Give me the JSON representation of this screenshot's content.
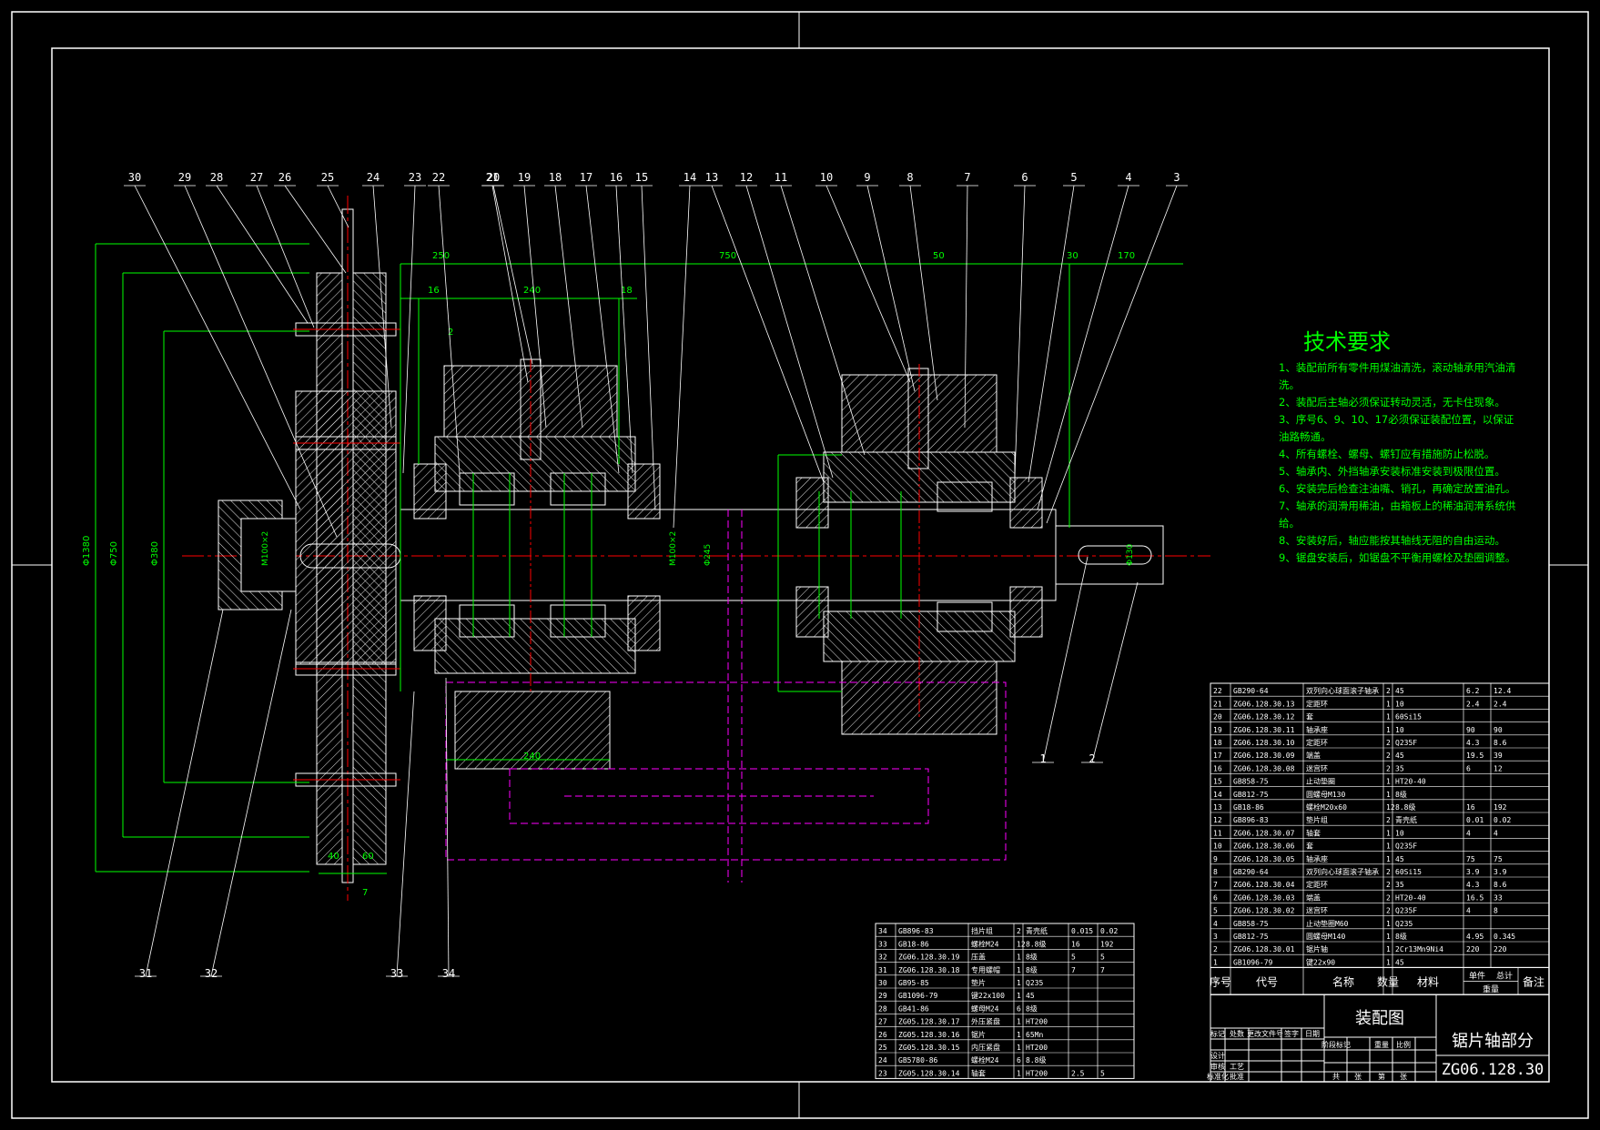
{
  "tech": {
    "title": "技术要求",
    "items": [
      "1、装配前所有零件用煤油清洗，滚动轴承用汽油清",
      "洗。",
      "2、装配后主轴必须保证转动灵活，无卡住现象。",
      "3、序号6、9、10、17必须保证装配位置，以保证",
      "油路畅通。",
      "4、所有螺栓、螺母、螺钉应有措施防止松脱。",
      "5、轴承内、外挡轴承安装标准安装到极限位置。",
      "6、安装完后检查注油嘴、销孔，再确定放置油孔。",
      "7、轴承的润滑用稀油，由箱板上的稀油润滑系统供",
      "给。",
      "8、安装好后，轴应能按其轴线无阻的自由运动。",
      "9、锯盘安装后，如锯盘不平衡用螺栓及垫圈调整。"
    ]
  },
  "balloons_top": [
    "30",
    "29",
    "28",
    "27",
    "26",
    "25",
    "24",
    "23",
    "22",
    "21",
    "20",
    "19",
    "18",
    "17",
    "16",
    "15",
    "14",
    "13",
    "12",
    "11",
    "10",
    "9",
    "8",
    "7",
    "6",
    "5",
    "4",
    "3"
  ],
  "balloons_bottom_left": [
    "31",
    "32",
    "33",
    "34"
  ],
  "balloons_bottom_right": [
    "1",
    "2"
  ],
  "dims": {
    "top_left": "250",
    "top_mid": "750",
    "top_50": "50",
    "top_30": "30",
    "top_170": "170",
    "d16": "16",
    "d240": "240",
    "d18": "18",
    "d2": "2",
    "bottom_40": "40",
    "bottom_60": "60",
    "bottom_7": "7",
    "bottom_240": "240",
    "phi1": "Φ1380",
    "phi2": "Φ750",
    "phi3": "Φ380",
    "m1": "M100×2",
    "m2": "M100×2",
    "s1": "Φ245",
    "s2": "Φ130"
  },
  "bom_left": {
    "rows": [
      [
        "34",
        "GB896-83",
        "挡片组",
        "2",
        "青壳纸",
        "0.015",
        "0.02"
      ],
      [
        "33",
        "GB18-86",
        "螺栓M24",
        "12",
        "8.8级",
        "16",
        "192"
      ],
      [
        "32",
        "ZG06.128.30.19",
        "压盖",
        "1",
        "8级",
        "5",
        "5"
      ],
      [
        "31",
        "ZG06.128.30.18",
        "专用螺帽",
        "1",
        "8级",
        "7",
        "7"
      ],
      [
        "30",
        "GB95-85",
        "垫片",
        "1",
        "Q235",
        "",
        ""
      ],
      [
        "29",
        "GB1096-79",
        "键22x100",
        "1",
        "45",
        "",
        ""
      ],
      [
        "28",
        "GB41-86",
        "螺母M24",
        "6",
        "8级",
        "",
        ""
      ],
      [
        "27",
        "ZG05.128.30.17",
        "外压紧盘",
        "1",
        "HT200",
        "",
        ""
      ],
      [
        "26",
        "ZG05.128.30.16",
        "锯片",
        "1",
        "65Mn",
        "",
        ""
      ],
      [
        "25",
        "ZG05.128.30.15",
        "内压紧盘",
        "1",
        "HT200",
        "",
        ""
      ],
      [
        "24",
        "GB5780-86",
        "螺栓M24",
        "6",
        "8.8级",
        "",
        ""
      ],
      [
        "23",
        "ZG05.128.30.14",
        "轴套",
        "1",
        "HT200",
        "2.5",
        "5"
      ]
    ]
  },
  "bom_right": {
    "rows": [
      [
        "22",
        "GB290-64",
        "双列向心球面滚子轴承",
        "2",
        "45",
        "6.2",
        "12.4"
      ],
      [
        "21",
        "ZG06.128.30.13",
        "定距环",
        "1",
        "10",
        "2.4",
        "2.4"
      ],
      [
        "20",
        "ZG06.128.30.12",
        "套",
        "1",
        "60Si15",
        "",
        ""
      ],
      [
        "19",
        "ZG06.128.30.11",
        "轴承座",
        "1",
        "10",
        "90",
        "90"
      ],
      [
        "18",
        "ZG06.128.30.10",
        "定距环",
        "2",
        "Q235F",
        "4.3",
        "8.6"
      ],
      [
        "17",
        "ZG06.128.30.09",
        "端盖",
        "2",
        "45",
        "19.5",
        "39"
      ],
      [
        "16",
        "ZG06.128.30.08",
        "迷宫环",
        "2",
        "35",
        "6",
        "12"
      ],
      [
        "15",
        "GB858-75",
        "止动垫圈",
        "1",
        "HT20-40",
        "",
        ""
      ],
      [
        "14",
        "GB812-75",
        "圆螺母M130",
        "1",
        "8级",
        "",
        ""
      ],
      [
        "13",
        "GB18-86",
        "螺栓M20x60",
        "12",
        "8.8级",
        "16",
        "192"
      ],
      [
        "12",
        "GB896-83",
        "垫片组",
        "2",
        "青壳纸",
        "0.01",
        "0.02"
      ],
      [
        "11",
        "ZG06.128.30.07",
        "轴套",
        "1",
        "10",
        "4",
        "4"
      ],
      [
        "10",
        "ZG06.128.30.06",
        "套",
        "1",
        "Q235F",
        "",
        ""
      ],
      [
        "9",
        "ZG06.128.30.05",
        "轴承座",
        "1",
        "45",
        "75",
        "75"
      ],
      [
        "8",
        "GB290-64",
        "双列向心球面滚子轴承",
        "2",
        "60Si15",
        "3.9",
        "3.9"
      ],
      [
        "7",
        "ZG06.128.30.04",
        "定距环",
        "2",
        "35",
        "4.3",
        "8.6"
      ],
      [
        "6",
        "ZG06.128.30.03",
        "端盖",
        "2",
        "HT20-40",
        "16.5",
        "33"
      ],
      [
        "5",
        "ZG06.128.30.02",
        "迷宫环",
        "2",
        "Q235F",
        "4",
        "8"
      ],
      [
        "4",
        "GB858-75",
        "止动垫圈M60",
        "1",
        "Q235",
        "",
        ""
      ],
      [
        "3",
        "GB812-75",
        "圆螺母M140",
        "1",
        "8级",
        "4.95",
        "0.345"
      ],
      [
        "2",
        "ZG06.128.30.01",
        "锯片轴",
        "1",
        "2Cr13Mn9Ni4",
        "220",
        "220"
      ],
      [
        "1",
        "GB1096-79",
        "键22x90",
        "1",
        "45",
        "",
        ""
      ]
    ],
    "header": [
      "序号",
      "代号",
      "名称",
      "数量",
      "材料",
      "单件",
      "总计",
      "备注"
    ],
    "weight_label": "重量"
  },
  "title_block": {
    "drawing_kind": "装配图",
    "part_name": "锯片轴部分",
    "code": "ZG06.128.30",
    "small": [
      "标记",
      "处数",
      "更改文件号",
      "签字",
      "日期",
      "设计",
      "标准化",
      "阶段标记",
      "重量",
      "比例",
      "审核",
      "工艺",
      "批准",
      "共",
      "张",
      "第",
      "张"
    ]
  },
  "colors": {
    "green": "#00ff00",
    "red": "#ff0000",
    "magenta": "#ff00ff",
    "white": "#ffffff",
    "yellow": "#ffff00",
    "cyan": "#00ffff"
  }
}
